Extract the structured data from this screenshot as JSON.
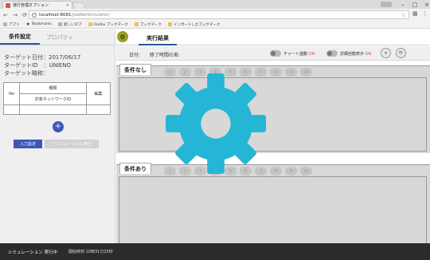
{
  "browser": {
    "tab_title": "運行管理オプション",
    "tab_close": "×",
    "url_host": "localhost:8081",
    "url_path": "/JobNetSimulator/",
    "window_controls": [
      "–",
      "□",
      "×"
    ],
    "bookmarks": [
      "アプリ",
      "Bookmarks",
      "新しいタブ",
      "Firefox ブックマーク",
      "ブックマーク",
      "インポートしたブックマーク"
    ]
  },
  "left_panel": {
    "tabs": [
      "条件設定",
      "プロパティ"
    ],
    "target_date_label": "ターゲット日付：",
    "target_date": "2017/06/17",
    "target_id_label": "ターゲットID　：",
    "target_id": "UNIENO",
    "target_short_label": "ターゲット略称：",
    "table": {
      "no_header": "No",
      "kind_header": "種類",
      "network_header": "対象ネットワークID",
      "edit_header": "編集"
    },
    "add_label": "+",
    "buttons": {
      "input_settings": "入力設定",
      "simulation_run": "シミュレーション実行"
    }
  },
  "right_panel": {
    "settings_icon": "gear",
    "title": "実行結果",
    "date_label": "日付:",
    "end_time_label": "終了時間の差:",
    "chart_link_label": "チャート連動",
    "chart_link_state": "ON",
    "auto_detail_label": "詳細自動表示",
    "auto_detail_state": "ON",
    "pause_label": "⏸",
    "refresh_label": "⟳",
    "sections": [
      {
        "title": "条件なし",
        "pages": [
          "1",
          "2",
          "3",
          "4",
          "5",
          "6",
          "7",
          "8",
          "9",
          "10"
        ]
      },
      {
        "title": "条件あり",
        "pages": [
          "1",
          "2",
          "3",
          "4",
          "5",
          "6",
          "7",
          "8",
          "9",
          "10"
        ]
      }
    ]
  },
  "statusbar": {
    "status": "シミュレーション 実行中",
    "start_time": "開始時刻 10時31分25秒"
  },
  "colors": {
    "accent": "#3d57b8",
    "gear_overlay": "#24b6d4",
    "settings_btn": "#9aa01e",
    "statusbar": "#2b2b2b"
  }
}
